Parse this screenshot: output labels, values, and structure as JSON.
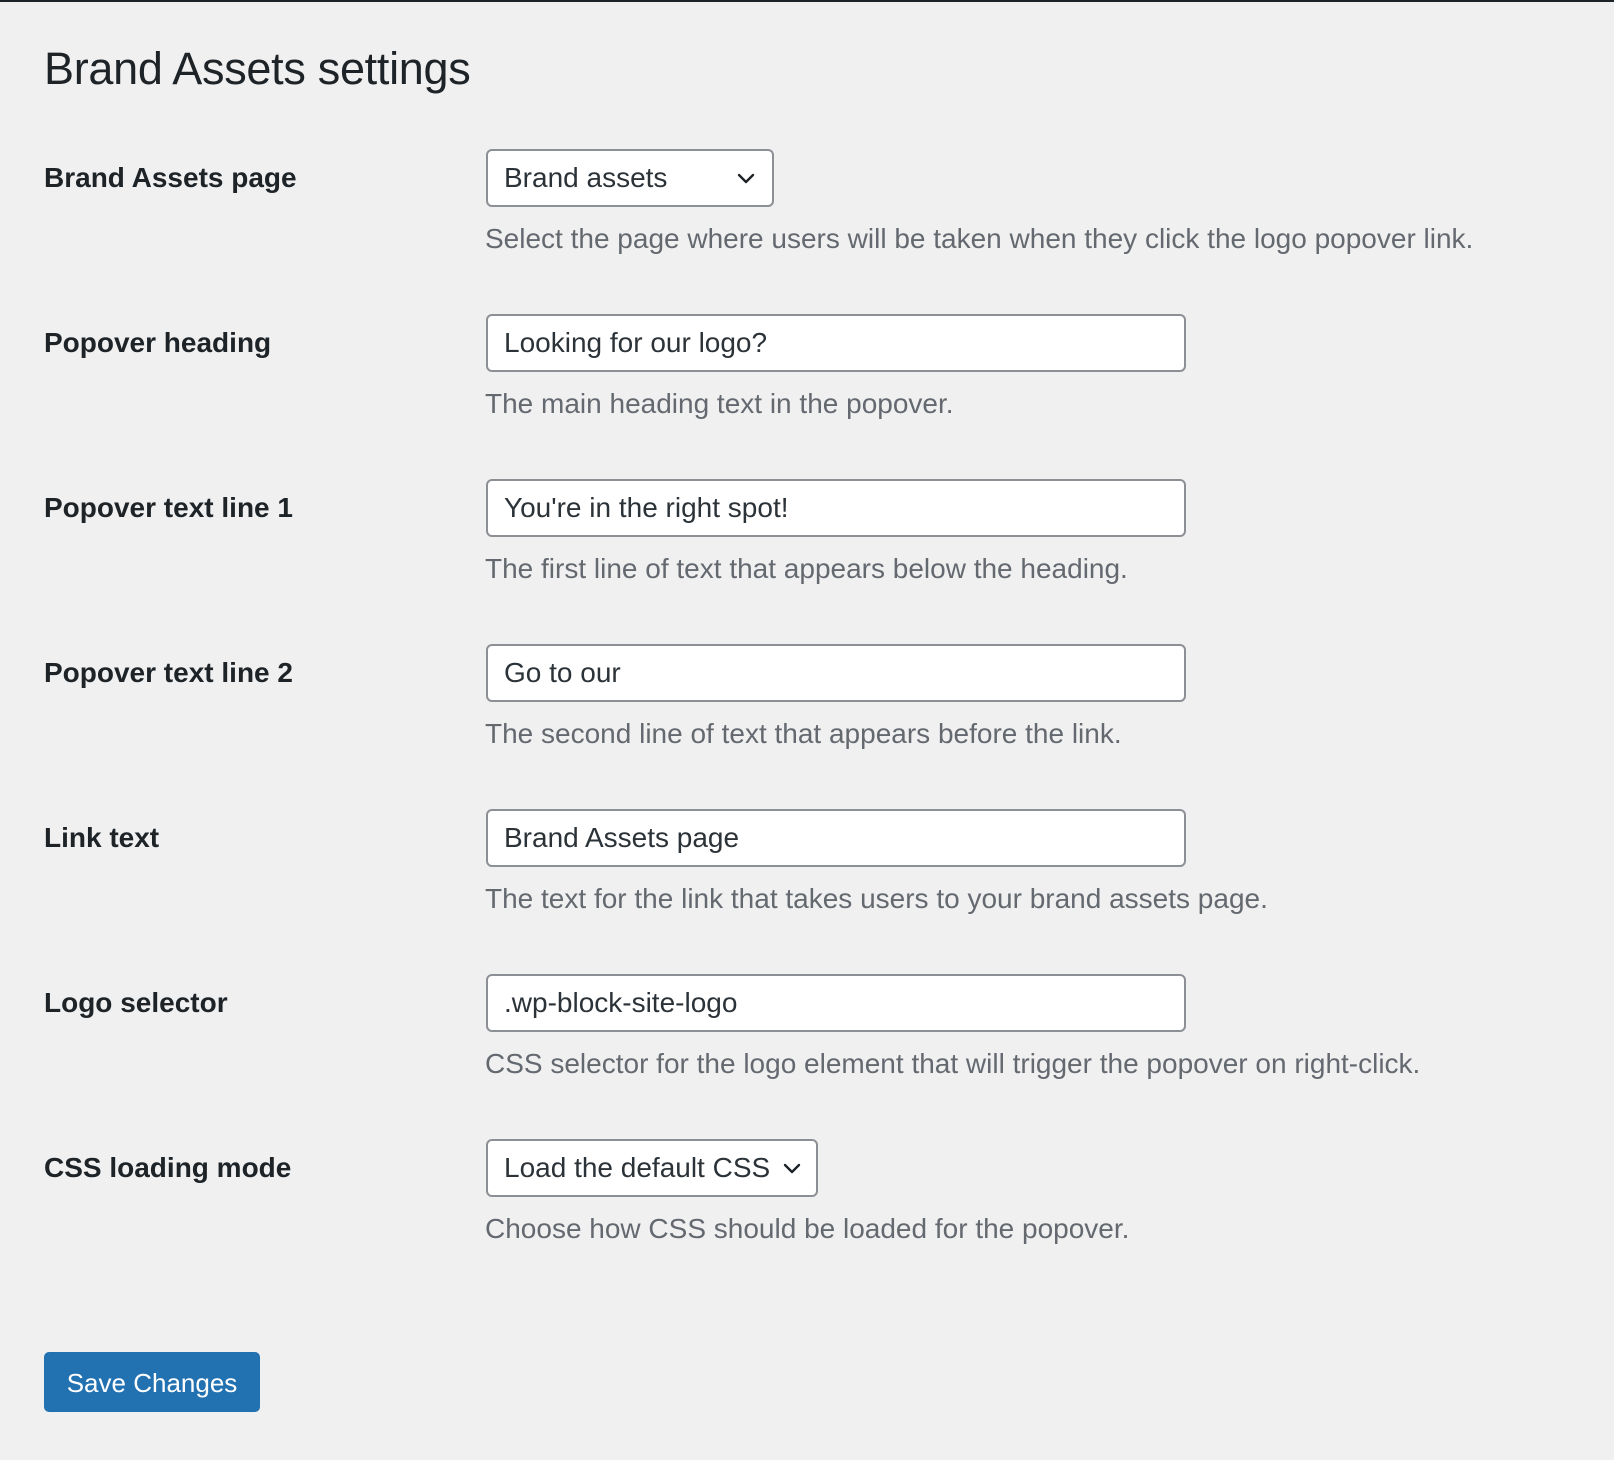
{
  "page": {
    "title": "Brand Assets settings"
  },
  "fields": {
    "brand_assets_page": {
      "label": "Brand Assets page",
      "value": "Brand assets",
      "description": "Select the page where users will be taken when they click the logo popover link."
    },
    "popover_heading": {
      "label": "Popover heading",
      "value": "Looking for our logo?",
      "description": "The main heading text in the popover."
    },
    "popover_text_line_1": {
      "label": "Popover text line 1",
      "value": "You're in the right spot!",
      "description": "The first line of text that appears below the heading."
    },
    "popover_text_line_2": {
      "label": "Popover text line 2",
      "value": "Go to our",
      "description": "The second line of text that appears before the link."
    },
    "link_text": {
      "label": "Link text",
      "value": "Brand Assets page",
      "description": "The text for the link that takes users to your brand assets page."
    },
    "logo_selector": {
      "label": "Logo selector",
      "value": ".wp-block-site-logo",
      "description": "CSS selector for the logo element that will trigger the popover on right-click."
    },
    "css_loading_mode": {
      "label": "CSS loading mode",
      "value": "Load the default CSS",
      "description": "Choose how CSS should be loaded for the popover."
    }
  },
  "actions": {
    "save_label": "Save Changes"
  },
  "icons": {
    "select_chevron": "chevron-down-icon"
  },
  "colors": {
    "background": "#f0f0f1",
    "primary_button": "#2271b1",
    "input_border": "#8c8f94",
    "description_text": "#646970",
    "label_text": "#1d2327"
  }
}
